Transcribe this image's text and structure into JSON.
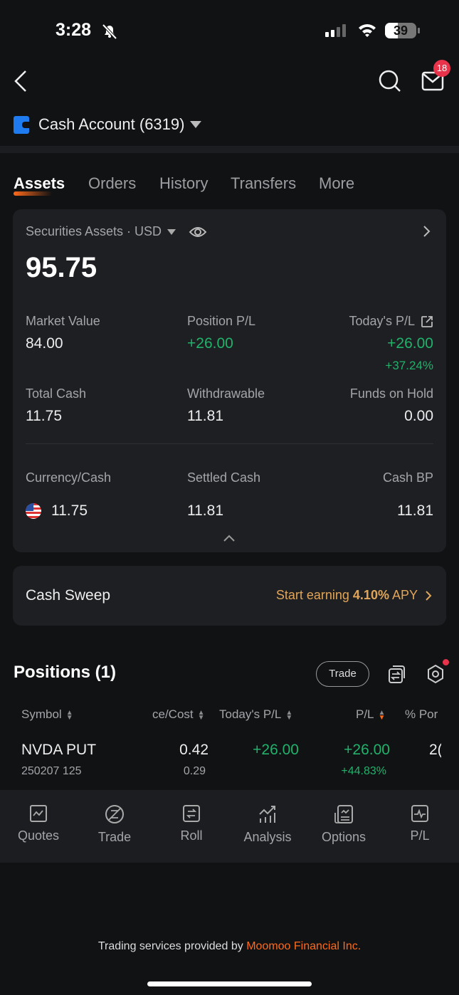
{
  "status_bar": {
    "time": "3:28",
    "battery": "39"
  },
  "header": {
    "mail_badge": "18",
    "account": "Cash Account (6319)"
  },
  "tabs": [
    {
      "label": "Assets",
      "active": true
    },
    {
      "label": "Orders"
    },
    {
      "label": "History"
    },
    {
      "label": "Transfers"
    },
    {
      "label": "More"
    }
  ],
  "assets": {
    "title": "Securities Assets · USD",
    "total": "95.75",
    "market_value_label": "Market Value",
    "market_value": "84.00",
    "position_pl_label": "Position P/L",
    "position_pl": "+26.00",
    "todays_pl_label": "Today's P/L",
    "todays_pl": "+26.00",
    "todays_pl_pct": "+37.24%",
    "total_cash_label": "Total Cash",
    "total_cash": "11.75",
    "withdrawable_label": "Withdrawable",
    "withdrawable": "11.81",
    "funds_on_hold_label": "Funds on Hold",
    "funds_on_hold": "0.00",
    "currency_cash_label": "Currency/Cash",
    "currency_cash": "11.75",
    "settled_cash_label": "Settled Cash",
    "settled_cash": "11.81",
    "cash_bp_label": "Cash BP",
    "cash_bp": "11.81"
  },
  "cash_sweep": {
    "label": "Cash Sweep",
    "cta_prefix": "Start earning ",
    "cta_rate": "4.10%",
    "cta_suffix": " APY"
  },
  "positions": {
    "title": "Positions (1)",
    "trade_button": "Trade",
    "columns": [
      "Symbol",
      "ce/Cost",
      "Today's P/L",
      "P/L",
      "% Por"
    ],
    "rows": [
      {
        "symbol": "NVDA PUT",
        "sub": "250207 125",
        "price": "0.42",
        "cost": "0.29",
        "todays_pl": "+26.00",
        "pl": "+26.00",
        "pl_pct": "+44.83%",
        "portfolio": "2("
      }
    ]
  },
  "bottom_nav": [
    {
      "label": "Quotes",
      "icon": "quotes-icon"
    },
    {
      "label": "Trade",
      "icon": "trade-icon"
    },
    {
      "label": "Roll",
      "icon": "roll-icon"
    },
    {
      "label": "Analysis",
      "icon": "analysis-icon"
    },
    {
      "label": "Options",
      "icon": "options-icon"
    },
    {
      "label": "P/L",
      "icon": "pl-icon"
    }
  ],
  "footer": {
    "prefix": "Trading services provided by ",
    "company": "Moomoo Financial Inc."
  },
  "colors": {
    "accent": "#ff6a1a",
    "green": "#20b26b",
    "gold": "#e0a55a",
    "badge": "#e8334a",
    "card": "#1e1f22",
    "background": "#111214"
  }
}
